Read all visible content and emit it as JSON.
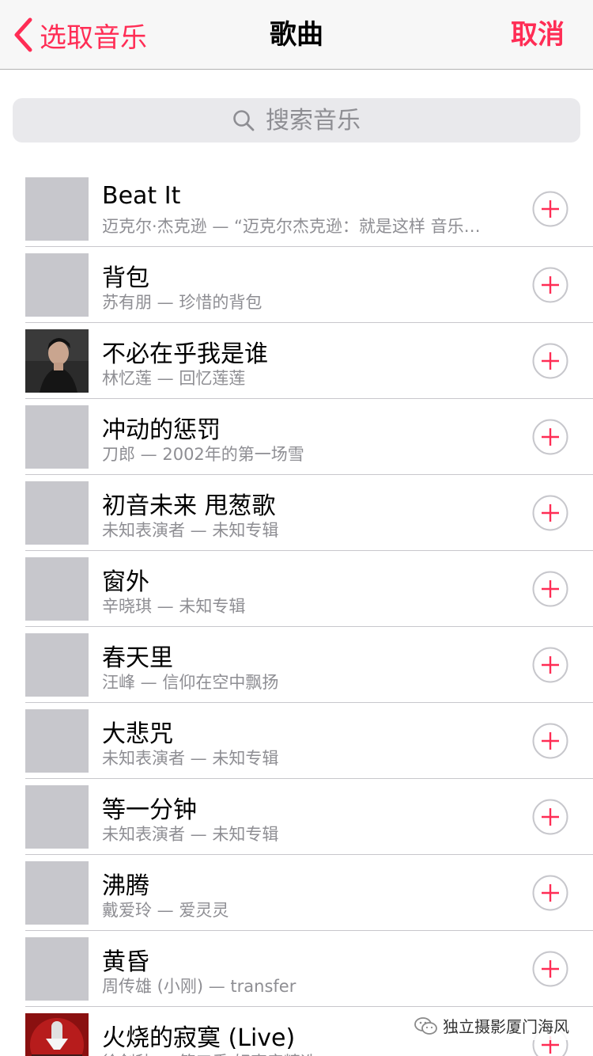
{
  "colors": {
    "accent": "#ff2d55",
    "subtitle": "#8e8e93",
    "separator": "#c8c7cc",
    "artwork_placeholder": "#c7c7cc",
    "navbar_bg": "#f7f7f7",
    "search_bg": "#e9e9ec"
  },
  "navbar": {
    "back_label": "选取音乐",
    "back_icon": "chevron-left-icon",
    "title": "歌曲",
    "cancel_label": "取消"
  },
  "search": {
    "placeholder": "搜索音乐",
    "value": "",
    "icon": "search-icon"
  },
  "songs": [
    {
      "title": "Beat It",
      "subtitle": "迈克尔·杰克逊 — “迈克尔杰克逊：就是这样 音乐…",
      "artwork": "placeholder"
    },
    {
      "title": "背包",
      "subtitle": "苏有朋 — 珍惜的背包",
      "artwork": "placeholder"
    },
    {
      "title": "不必在乎我是谁",
      "subtitle": "林忆莲 — 回忆莲莲",
      "artwork": "photo-portrait"
    },
    {
      "title": "冲动的惩罚",
      "subtitle": "刀郎 — 2002年的第一场雪",
      "artwork": "placeholder"
    },
    {
      "title": "初音未来 甩葱歌",
      "subtitle": "未知表演者 — 未知专辑",
      "artwork": "placeholder"
    },
    {
      "title": "窗外",
      "subtitle": "辛晓琪 — 未知专辑",
      "artwork": "placeholder"
    },
    {
      "title": "春天里",
      "subtitle": "汪峰 — 信仰在空中飘扬",
      "artwork": "placeholder"
    },
    {
      "title": "大悲咒",
      "subtitle": "未知表演者 — 未知专辑",
      "artwork": "placeholder"
    },
    {
      "title": "等一分钟",
      "subtitle": "未知表演者 — 未知专辑",
      "artwork": "placeholder"
    },
    {
      "title": "沸腾",
      "subtitle": "戴爱玲 — 爱灵灵",
      "artwork": "placeholder"
    },
    {
      "title": "黄昏",
      "subtitle": "周传雄 (小刚) — transfer",
      "artwork": "placeholder"
    },
    {
      "title": "火烧的寂寞 (Live)",
      "subtitle": "徐剑秋 — 第三季 好声音精选",
      "artwork": "photo-voice"
    }
  ],
  "add_icon": "plus-circle-icon",
  "watermark": {
    "text": "独立摄影厦门海风",
    "icon": "wechat-icon"
  }
}
